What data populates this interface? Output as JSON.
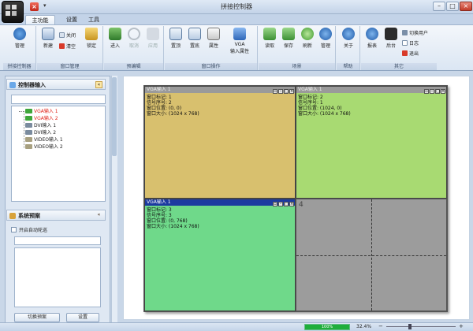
{
  "window": {
    "title": "拼接控制器",
    "qat_close": "×",
    "qat_dropdown": "▾",
    "minimize": "–",
    "maximize": "□",
    "close": "×"
  },
  "tabs": [
    {
      "label": "主功能",
      "active": true
    },
    {
      "label": "设置"
    },
    {
      "label": "工具"
    }
  ],
  "ribbon": {
    "groups": [
      {
        "label": "拼接控制器",
        "buttons": [
          "管理"
        ]
      },
      {
        "label": "窗口管理",
        "buttons": [
          "新建",
          "关闭",
          "清空",
          "锁定"
        ]
      },
      {
        "label": "预编辑",
        "buttons": [
          "进入",
          "取消",
          "应用"
        ]
      },
      {
        "label": "窗口操作",
        "buttons": [
          "置顶",
          "置底",
          "属性",
          "VGA",
          "输入属性"
        ]
      },
      {
        "label": "场景",
        "buttons": [
          "读取",
          "保存",
          "刷新",
          "管理"
        ]
      },
      {
        "label": "帮助",
        "buttons": [
          "关于"
        ]
      },
      {
        "label": "其它",
        "buttons": [
          "报表",
          "后台",
          "切换用户",
          "日志",
          "退出"
        ]
      }
    ]
  },
  "left_panel": {
    "input_section": {
      "title": "控制器输入",
      "items": [
        {
          "label": "VGA输入 1",
          "color": "#e0241a"
        },
        {
          "label": "VGA输入 2",
          "color": "#e0241a"
        },
        {
          "label": "DVI输入 1",
          "color": "#222222"
        },
        {
          "label": "DVI输入 2",
          "color": "#222222"
        },
        {
          "label": "VIDEO输入 1",
          "color": "#222222"
        },
        {
          "label": "VIDEO输入 2",
          "color": "#222222"
        }
      ]
    },
    "plan_section": {
      "title": "系统预案",
      "auto_rotate": "开启自动轮巡",
      "switch_button": "切换预案",
      "settings_button": "设置"
    }
  },
  "wall": {
    "windows": [
      {
        "title": "VGA输入 1",
        "info": "窗口标记: 1\n信号序号: 2\n窗口位置: (0, 0)\n窗口大小: (1024 x 768)"
      },
      {
        "title": "VGA输入 1",
        "info": "窗口标记: 2\n信号序号: 1\n窗口位置: (1024, 0)\n窗口大小: (1024 x 768)"
      },
      {
        "title": "VGA输入 1",
        "info": "窗口标记: 3\n信号序号: 3\n窗口位置: (0, 768)\n窗口大小: (1024 x 768)"
      }
    ],
    "empty_cell_number": "4",
    "win_buttons": [
      "▫",
      "–",
      "□",
      "×"
    ]
  },
  "status": {
    "progress_text": "100%",
    "progress": 1.0,
    "zoom": "32.4%",
    "zoom_minus": "−",
    "zoom_plus": "+"
  },
  "colors": {
    "accent": "#1c3aa0",
    "win1_bg": "#d8c06e",
    "win2_bg": "#a8da72",
    "win3_bg": "#6fd98a"
  }
}
